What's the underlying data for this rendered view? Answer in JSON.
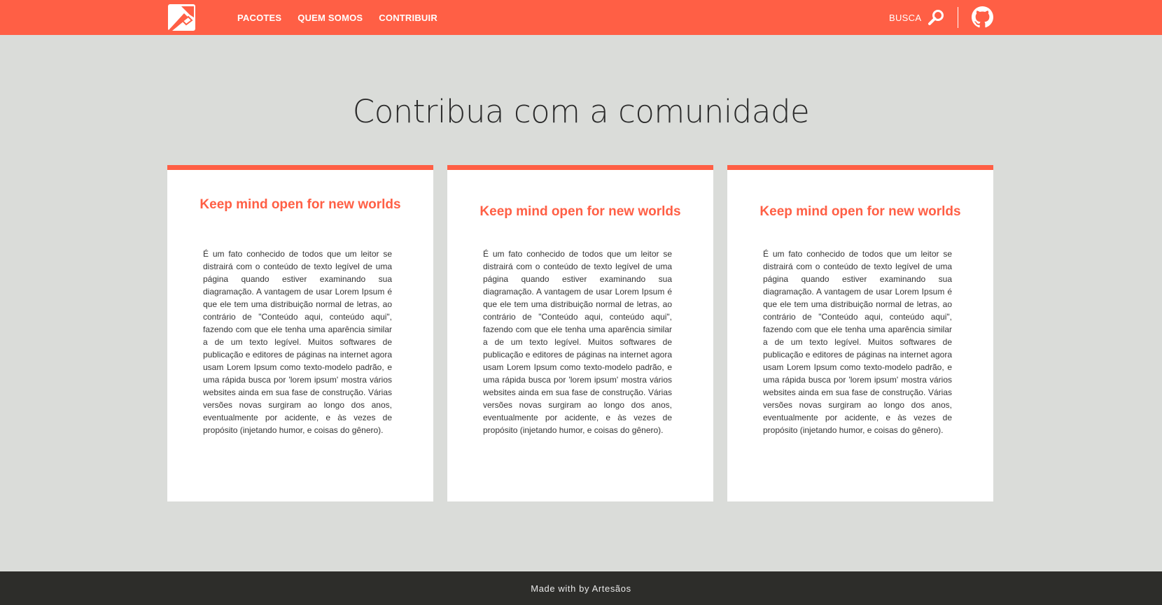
{
  "header": {
    "nav": [
      "PACOTES",
      "QUEM SOMOS",
      "CONTRIBUIR"
    ],
    "search_label": "BUSCA",
    "colors": {
      "bar": "#ff5f45",
      "text": "#ffffff"
    },
    "icons": {
      "logo": "artesaos-logo",
      "search": "search-icon",
      "github": "github-icon"
    }
  },
  "main": {
    "title": "Contribua com a comunidade",
    "cards": [
      {
        "title": "Keep mind open for new worlds",
        "text": "É um fato conhecido de todos que um leitor se distrairá com o conteúdo de texto legível de uma página quando estiver examinando sua diagramação. A vantagem de usar Lorem Ipsum é que ele tem uma distribuição normal de letras, ao contrário de \"Conteúdo aqui, conteúdo aqui\", fazendo com que ele tenha uma aparência similar a de um texto legível. Muitos softwares de publicação e editores de páginas na internet agora usam Lorem Ipsum como texto-modelo padrão, e uma rápida busca por 'lorem ipsum' mostra vários websites ainda em sua fase de construção. Várias versões novas surgiram ao longo dos anos, eventualmente por acidente, e às vezes de propósito (injetando humor, e coisas do gênero)."
      },
      {
        "title": "Keep mind open for new worlds",
        "text": "É um fato conhecido de todos que um leitor se distrairá com o conteúdo de texto legível de uma página quando estiver examinando sua diagramação. A vantagem de usar Lorem Ipsum é que ele tem uma distribuição normal de letras, ao contrário de \"Conteúdo aqui, conteúdo aqui\", fazendo com que ele tenha uma aparência similar a de um texto legível. Muitos softwares de publicação e editores de páginas na internet agora usam Lorem Ipsum como texto-modelo padrão, e uma rápida busca por 'lorem ipsum' mostra vários websites ainda em sua fase de construção. Várias versões novas surgiram ao longo dos anos, eventualmente por acidente, e às vezes de propósito (injetando humor, e coisas do gênero)."
      },
      {
        "title": "Keep mind open for new worlds",
        "text": "É um fato conhecido de todos que um leitor se distrairá com o conteúdo de texto legível de uma página quando estiver examinando sua diagramação. A vantagem de usar Lorem Ipsum é que ele tem uma distribuição normal de letras, ao contrário de \"Conteúdo aqui, conteúdo aqui\", fazendo com que ele tenha uma aparência similar a de um texto legível. Muitos softwares de publicação e editores de páginas na internet agora usam Lorem Ipsum como texto-modelo padrão, e uma rápida busca por 'lorem ipsum' mostra vários websites ainda em sua fase de construção. Várias versões novas surgiram ao longo dos anos, eventualmente por acidente, e às vezes de propósito (injetando humor, e coisas do gênero)."
      }
    ]
  },
  "footer": {
    "text": "Made with by Artesãos"
  }
}
